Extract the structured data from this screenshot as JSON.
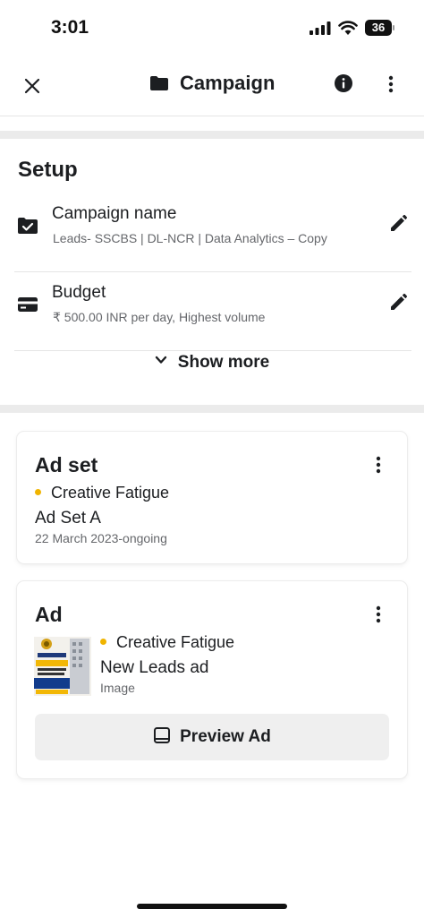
{
  "status_bar": {
    "time": "3:01",
    "battery": "36"
  },
  "nav": {
    "title": "Campaign",
    "icons": [
      "close-icon",
      "folder-icon",
      "info-icon",
      "more-vertical-icon"
    ]
  },
  "setup": {
    "title": "Setup",
    "rows": [
      {
        "label": "Campaign name",
        "value": "Leads- SSCBS | DL-NCR | Data Analytics – Copy",
        "icon": "folder-check-icon"
      },
      {
        "label": "Budget",
        "value": "₹ 500.00 INR per day, Highest volume",
        "icon": "credit-card-icon"
      }
    ],
    "show_more": "Show more"
  },
  "ad_set": {
    "title": "Ad set",
    "status": "Creative Fatigue",
    "name": "Ad Set A",
    "date": "22 March 2023-ongoing"
  },
  "ad": {
    "title": "Ad",
    "status": "Creative Fatigue",
    "name": "New Leads ad",
    "type": "Image",
    "preview_label": "Preview Ad"
  },
  "colors": {
    "status_dot": "#f0b400",
    "gap": "#ebebeb",
    "button_bg": "#efefef",
    "secondary_text": "#65676b"
  }
}
